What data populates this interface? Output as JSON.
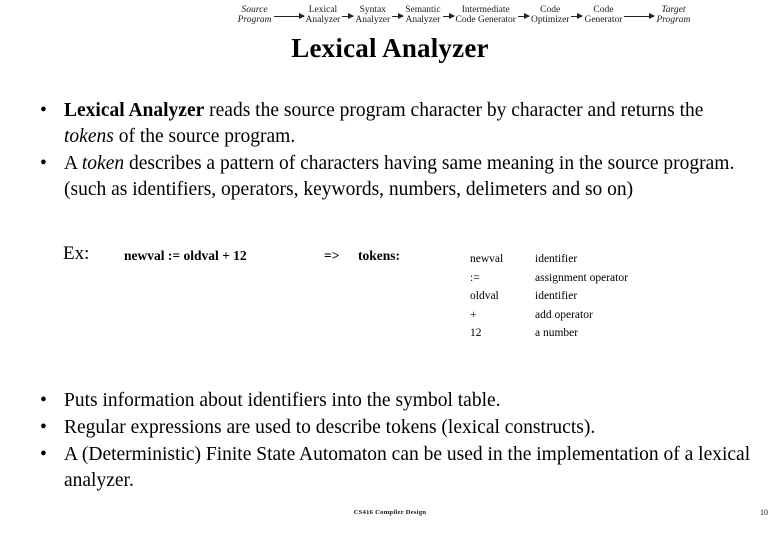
{
  "pipeline": {
    "stages": [
      {
        "lines": [
          "Source",
          "Program"
        ],
        "style": "italic-terminal"
      },
      {
        "lines": [
          "Lexical",
          "Analyzer"
        ],
        "style": "normal"
      },
      {
        "lines": [
          "Syntax",
          "Analyzer"
        ],
        "style": "normal"
      },
      {
        "lines": [
          "Semantic",
          "Analyzer"
        ],
        "style": "normal"
      },
      {
        "lines": [
          "Intermediate",
          "Code Generator"
        ],
        "style": "normal"
      },
      {
        "lines": [
          "Code",
          "Optimizer"
        ],
        "style": "normal"
      },
      {
        "lines": [
          "Code",
          "Generator"
        ],
        "style": "normal"
      },
      {
        "lines": [
          "Target",
          "Program"
        ],
        "style": "italic-terminal"
      }
    ]
  },
  "title": "Lexical Analyzer",
  "bullets_top": [
    {
      "marker": "•",
      "segments": [
        {
          "text": "Lexical Analyzer",
          "style": "bold"
        },
        {
          "text": " reads the source program character by character and returns the ",
          "style": "normal"
        },
        {
          "text": "tokens",
          "style": "italic"
        },
        {
          "text": " of the source program.",
          "style": "normal"
        }
      ]
    },
    {
      "marker": "•",
      "segments": [
        {
          "text": "A ",
          "style": "normal"
        },
        {
          "text": "token",
          "style": "italic"
        },
        {
          "text": " describes a pattern of characters having same meaning in the source program. (such as identifiers, operators, keywords, numbers, delimeters and so on)",
          "style": "normal"
        }
      ]
    }
  ],
  "example": {
    "label": "Ex:",
    "expression": "newval := oldval + 12",
    "arrow": "=>",
    "tokens_label": "tokens:",
    "token_table": {
      "rows": [
        {
          "lexeme": "newval",
          "description": "identifier"
        },
        {
          "lexeme": ":=",
          "description": "assignment operator"
        },
        {
          "lexeme": "oldval",
          "description": "identifier"
        },
        {
          "lexeme": "+",
          "description": "add operator"
        },
        {
          "lexeme": "12",
          "description": "a number"
        }
      ]
    }
  },
  "bullets_bottom": [
    {
      "marker": "•",
      "segments": [
        {
          "text": "Puts information about identifiers into the symbol table.",
          "style": "normal"
        }
      ]
    },
    {
      "marker": "•",
      "segments": [
        {
          "text": "Regular expressions are used to describe tokens (lexical constructs).",
          "style": "normal"
        }
      ]
    },
    {
      "marker": "•",
      "segments": [
        {
          "text": "A (Deterministic) Finite State Automaton can be used in the implementation of a lexical analyzer.",
          "style": "normal"
        }
      ]
    }
  ],
  "footer": {
    "note": "CS416 Compiler Design",
    "page_number": "10"
  },
  "colors": {
    "background": "#ffffff",
    "text": "#000000",
    "diagram_ink": "#222222"
  }
}
